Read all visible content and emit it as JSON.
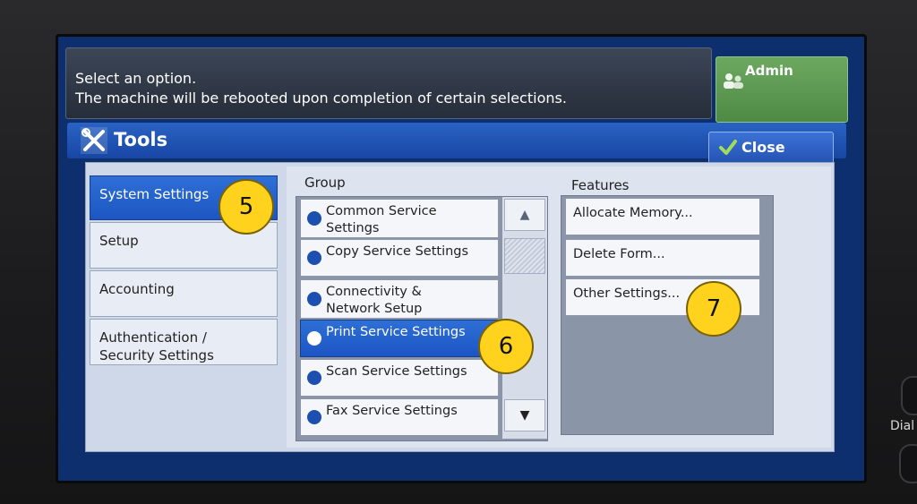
{
  "message": {
    "line1": "Select an option.",
    "line2": "The machine will be rebooted upon completion of certain selections."
  },
  "header": {
    "admin_label": "Admin",
    "title": "Tools",
    "close_label": "Close"
  },
  "tabs": [
    {
      "label": "System Settings",
      "active": true
    },
    {
      "label": "Setup",
      "active": false
    },
    {
      "label": "Accounting",
      "active": false
    },
    {
      "label": "Authentication /\nSecurity Settings",
      "active": false
    }
  ],
  "group": {
    "heading": "Group",
    "items": [
      {
        "label": "Common Service\nSettings",
        "active": false
      },
      {
        "label": "Copy Service Settings",
        "active": false
      },
      {
        "label": "Connectivity &\nNetwork Setup",
        "active": false
      },
      {
        "label": "Print Service Settings",
        "active": true
      },
      {
        "label": "Scan Service Settings",
        "active": false
      },
      {
        "label": "Fax Service Settings",
        "active": false
      }
    ],
    "scroll_up": "▲",
    "scroll_down": "▼"
  },
  "features": {
    "heading": "Features",
    "items": [
      {
        "label": "Allocate Memory..."
      },
      {
        "label": "Delete Form..."
      },
      {
        "label": "Other Settings..."
      }
    ]
  },
  "annotations": [
    "5",
    "6",
    "7"
  ],
  "bezel": {
    "dial_label": "Dial"
  },
  "colors": {
    "accent": "#1d56c2",
    "admin_green": "#5a9a4e",
    "badge": "#ffd21e",
    "panel": "#cfd8e8"
  }
}
